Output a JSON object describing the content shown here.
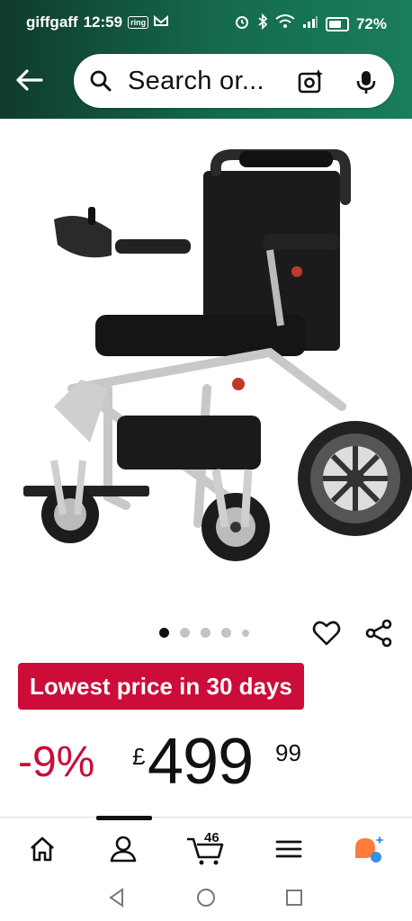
{
  "status_bar": {
    "carrier": "giffgaff",
    "time": "12:59",
    "notif_badge": "ring",
    "battery": "72%"
  },
  "search": {
    "placeholder": "Search or..."
  },
  "carousel": {
    "total": 5,
    "active_index": 0
  },
  "product": {
    "deal_badge": "Lowest price in 30 days",
    "discount": "-9%",
    "currency": "£",
    "price_whole": "499",
    "price_fraction": "99"
  },
  "bottom_nav": {
    "cart_count": "46",
    "items": [
      "home",
      "account",
      "cart",
      "menu",
      "ai-assistant"
    ]
  },
  "colors": {
    "header_dark": "#0f3b2a",
    "header_light": "#1a7d5c",
    "deal_red": "#cc0c39",
    "assistant_orange": "#ff7a3d",
    "assistant_blue": "#3a8ee6"
  }
}
